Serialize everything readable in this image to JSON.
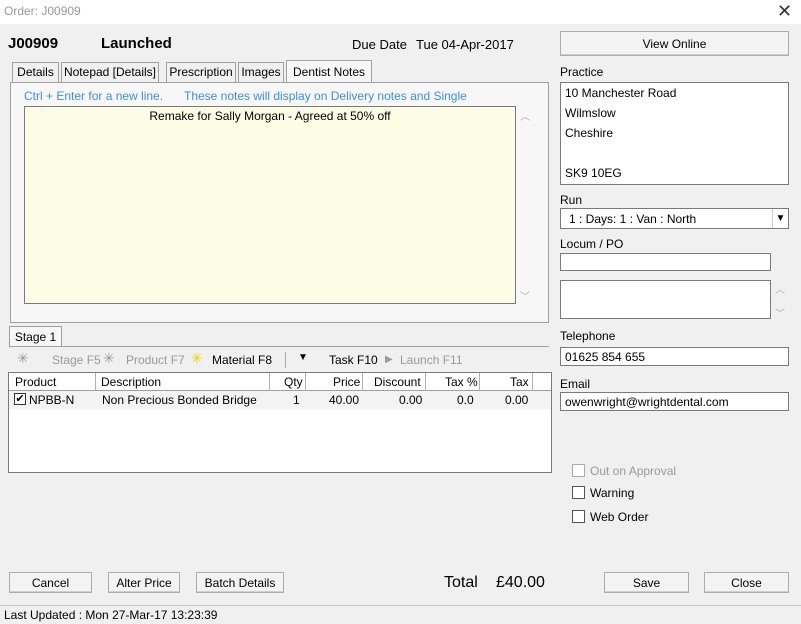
{
  "window": {
    "title": "Order: J00909",
    "close_glyph": "✕"
  },
  "header": {
    "order_number": "J00909",
    "status": "Launched",
    "due_label": "Due Date",
    "due_value": "Tue 04-Apr-2017"
  },
  "tabs": [
    {
      "label": "Details"
    },
    {
      "label": "Notepad [Details]"
    },
    {
      "label": "Prescription"
    },
    {
      "label": "Images"
    },
    {
      "label": "Dentist Notes",
      "active": true
    }
  ],
  "notes": {
    "hint_1": "Ctrl + Enter for a new line.",
    "hint_2": "These notes will display on Delivery notes and Single",
    "text": "Remake for Sally Morgan - Agreed at 50% off"
  },
  "stage_tab": "Stage 1",
  "toolbar": {
    "stage": "Stage F5",
    "product": "Product F7",
    "material": "Material F8",
    "task": "Task F10",
    "launch": "Launch F11"
  },
  "grid": {
    "columns": [
      "Product",
      "Description",
      "Qty",
      "Price",
      "Discount",
      "Tax %",
      "Tax"
    ],
    "rows": [
      {
        "checked": true,
        "product": "NPBB-N",
        "description": "Non Precious Bonded Bridge",
        "qty": "1",
        "price": "40.00",
        "discount": "0.00",
        "tax_pct": "0.0",
        "tax": "0.00"
      }
    ]
  },
  "right": {
    "view_online": "View Online",
    "practice_label": "Practice",
    "practice_lines": [
      "10 Manchester Road",
      "Wilmslow",
      "Cheshire",
      "",
      "SK9 10EG"
    ],
    "run_label": "Run",
    "run_value": "1 : Days: 1 : Van : North",
    "locum_label": "Locum / PO",
    "locum_value": "",
    "telephone_label": "Telephone",
    "telephone_value": "01625 854 655",
    "email_label": "Email",
    "email_value": "owenwright@wrightdental.com",
    "checkboxes": [
      {
        "label": "Out on Approval",
        "disabled": true
      },
      {
        "label": "Warning",
        "disabled": false
      },
      {
        "label": "Web Order",
        "disabled": false
      }
    ]
  },
  "buttons": {
    "cancel": "Cancel",
    "alter_price": "Alter Price",
    "batch_details": "Batch Details",
    "save": "Save",
    "close": "Close"
  },
  "totals": {
    "label": "Total",
    "value": "£40.00"
  },
  "footer": {
    "last_updated": "Last Updated : Mon 27-Mar-17 13:23:39"
  }
}
